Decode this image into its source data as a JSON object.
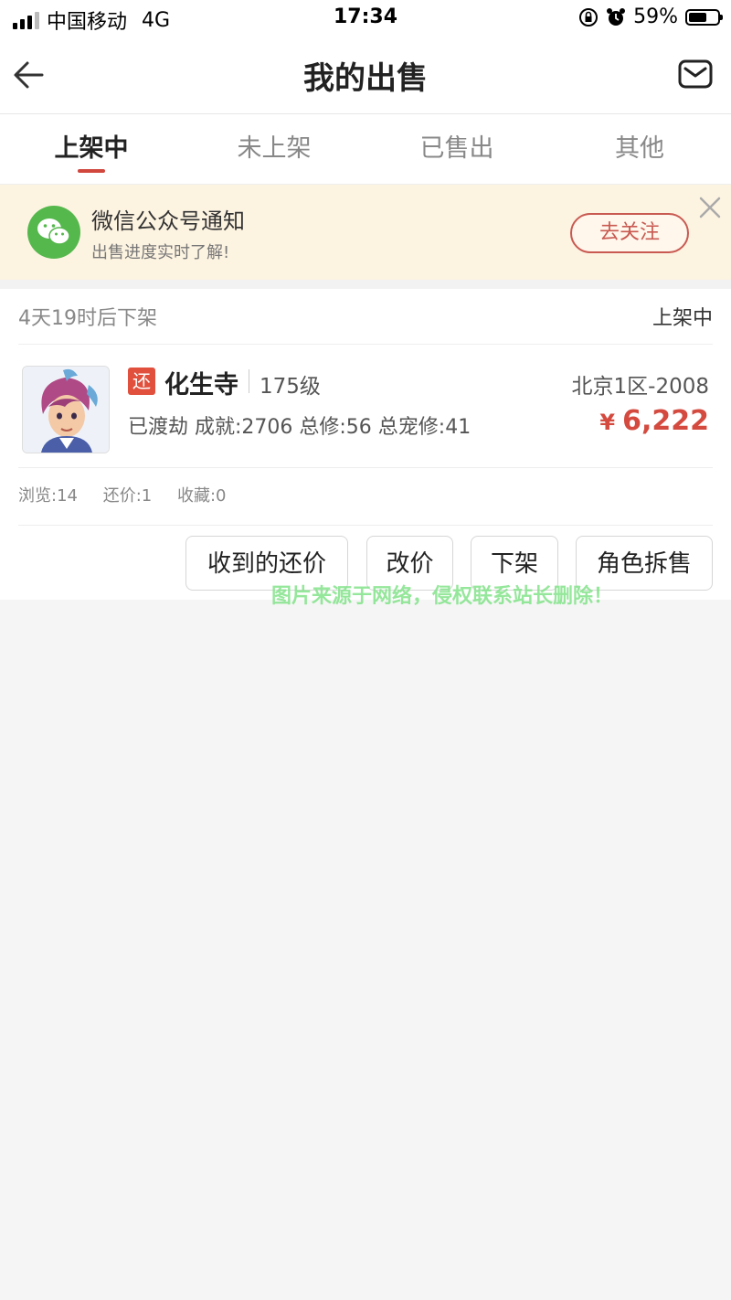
{
  "status_bar": {
    "carrier": "中国移动",
    "network": "4G",
    "time": "17:34",
    "battery_percent": "59%",
    "battery_level": 0.59
  },
  "nav": {
    "title": "我的出售",
    "back_icon": "arrow-left-icon",
    "mail_icon": "mail-icon"
  },
  "tabs": [
    {
      "label": "上架中",
      "active": true
    },
    {
      "label": "未上架",
      "active": false
    },
    {
      "label": "已售出",
      "active": false
    },
    {
      "label": "其他",
      "active": false
    }
  ],
  "notice": {
    "title": "微信公众号通知",
    "subtitle": "出售进度实时了解!",
    "button_label": "去关注",
    "icon": "wechat-icon",
    "close_icon": "close-icon"
  },
  "listing": {
    "time_left": "4天19时后下架",
    "status": "上架中",
    "badge": "还",
    "school": "化生寺",
    "level": "175级",
    "server": "北京1区-2008",
    "stats": "已渡劫 成就:2706 总修:56 总宠修:41",
    "currency": "¥",
    "price": "6,222",
    "views": "浏览:14",
    "offers": "还价:1",
    "favorites": "收藏:0",
    "actions": [
      "收到的还价",
      "改价",
      "下架",
      "角色拆售"
    ]
  },
  "watermark": "图片来源于网络，侵权联系站长删除！",
  "colors": {
    "accent": "#d44a3f",
    "notice_bg": "#fdf3e1",
    "wechat_green": "#55b84d",
    "watermark": "#83e38a"
  }
}
